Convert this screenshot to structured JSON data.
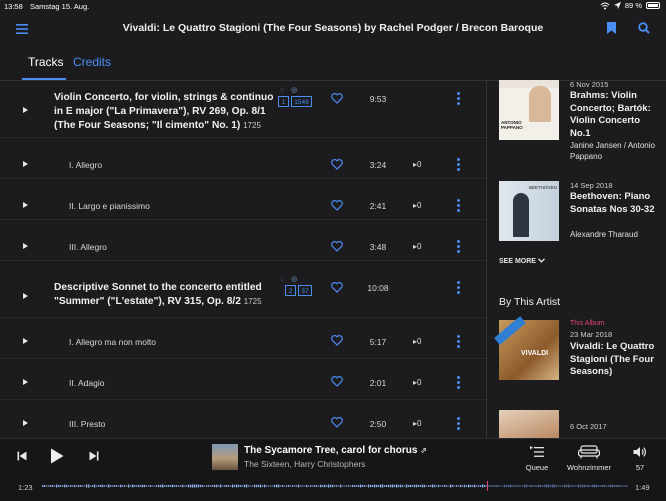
{
  "status": {
    "time": "13:58",
    "date": "Samstag 15. Aug.",
    "battery": "89 %"
  },
  "header": {
    "title": "Vivaldi: Le Quattro Stagioni (The Four Seasons) by Rachel Podger / Brecon Baroque"
  },
  "tabs": [
    {
      "label": "Tracks",
      "active": true
    },
    {
      "label": "Credits",
      "active": false
    }
  ],
  "works": [
    {
      "title": "Violin Concerto, for violin, strings & continuo in E major (\"La Primavera\"), RV 269, Op. 8/1 (The Four Seasons; \"Il cimento\" No. 1)",
      "year": "1725",
      "badge_recordings": "1",
      "badge_performances": "1549",
      "duration": "9:53",
      "movements": [
        {
          "title": "I. Allegro",
          "duration": "3:24",
          "popularity": "0"
        },
        {
          "title": "II. Largo e pianissimo",
          "duration": "2:41",
          "popularity": "0"
        },
        {
          "title": "III. Allegro",
          "duration": "3:48",
          "popularity": "0"
        }
      ]
    },
    {
      "title": "Descriptive Sonnet to the concerto entitled \"Summer\" (\"L'estate\"), RV 315, Op. 8/2",
      "year": "1725",
      "badge_recordings": "2",
      "badge_performances": "37",
      "duration": "10:08",
      "movements": [
        {
          "title": "I. Allegro ma non molto",
          "duration": "5:17",
          "popularity": "0"
        },
        {
          "title": "II. Adagio",
          "duration": "2:01",
          "popularity": "0"
        },
        {
          "title": "III. Presto",
          "duration": "2:50",
          "popularity": "0"
        }
      ]
    }
  ],
  "sidebar": {
    "related": [
      {
        "date": "6 Nov 2015",
        "title": "Brahms: Violin Concerto; Bartók: Violin Concerto No.1",
        "artist": "Janine Jansen / Antonio Pappano",
        "cover_text": "ANTONIO PAPPANO"
      },
      {
        "date": "14 Sep 2018",
        "title": "Beethoven: Piano Sonatas Nos 30-32",
        "artist": "Alexandre Tharaud",
        "cover_text": "BEETHOVEN"
      }
    ],
    "see_more": "SEE MORE",
    "by_artist_heading": "By This Artist",
    "by_artist": [
      {
        "badge": "This Album",
        "date": "23 Mar 2018",
        "title": "Vivaldi: Le Quattro Stagioni (The Four Seasons)",
        "cover_text": "VIVALDI"
      },
      {
        "date": "6 Oct 2017",
        "title": "",
        "cover_text": ""
      }
    ]
  },
  "player": {
    "track_title": "The Sycamore Tree, carol for chorus",
    "track_artist": "The Sixteen, Harry Christophers",
    "queue_label": "Queue",
    "room_label": "Wohnzimmer",
    "volume": "57",
    "elapsed": "1:23",
    "remaining": "1:49",
    "progress": 0.76
  },
  "colors": {
    "accent": "#4a8df5",
    "background": "#1c1c1e",
    "this_album": "#e0447a"
  }
}
